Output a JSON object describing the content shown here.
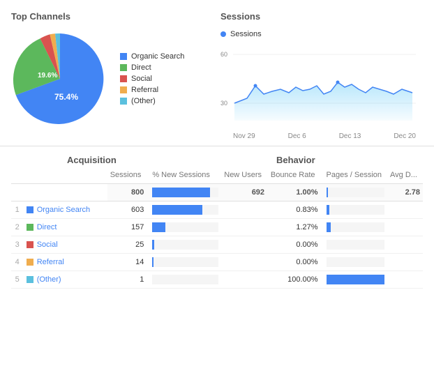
{
  "topChannels": {
    "title": "Top Channels",
    "legend": [
      {
        "label": "Organic Search",
        "color": "#4285f4",
        "pct": 75.4
      },
      {
        "label": "Direct",
        "color": "#5cb85c",
        "pct": 19.6
      },
      {
        "label": "Social",
        "color": "#d9534f",
        "pct": 2.5
      },
      {
        "label": "Referral",
        "color": "#f0ad4e",
        "pct": 1.5
      },
      {
        "label": "(Other)",
        "color": "#5bc0de",
        "pct": 1.0
      }
    ],
    "pieLabels": {
      "outer": "19.6%",
      "inner": "75.4%"
    }
  },
  "sessions": {
    "title": "Sessions",
    "dotLabel": "Sessions",
    "yLabels": [
      "60",
      "30"
    ],
    "xLabels": [
      "Nov 29",
      "Dec 6",
      "Dec 13",
      "Dec 20"
    ]
  },
  "table": {
    "acquisitionLabel": "Acquisition",
    "behaviorLabel": "Behavior",
    "columns": {
      "sessions": "Sessions",
      "pctNewSessions": "% New Sessions",
      "newUsers": "New Users",
      "bounceRate": "Bounce Rate",
      "pagesPerSession": "Pages / Session",
      "avgDuration": "Avg D..."
    },
    "totalRow": {
      "sessions": "800",
      "pctNew": "86.50%",
      "newUsers": "692",
      "bounceRate": "1.00%",
      "pages": "2.78"
    },
    "rows": [
      {
        "num": "1",
        "channel": "Organic Search",
        "color": "#4285f4",
        "sessions": "603",
        "barPct": 75,
        "bounceRate": "0.83%",
        "barPctBounce": 5
      },
      {
        "num": "2",
        "channel": "Direct",
        "color": "#5cb85c",
        "sessions": "157",
        "barPct": 20,
        "bounceRate": "1.27%",
        "barPctBounce": 8
      },
      {
        "num": "3",
        "channel": "Social",
        "color": "#d9534f",
        "sessions": "25",
        "barPct": 3,
        "bounceRate": "0.00%",
        "barPctBounce": 0
      },
      {
        "num": "4",
        "channel": "Referral",
        "color": "#f0ad4e",
        "sessions": "14",
        "barPct": 2,
        "bounceRate": "0.00%",
        "barPctBounce": 0
      },
      {
        "num": "5",
        "channel": "(Other)",
        "color": "#5bc0de",
        "sessions": "1",
        "barPct": 0,
        "bounceRate": "100.00%",
        "barPctBounce": 100
      }
    ]
  }
}
